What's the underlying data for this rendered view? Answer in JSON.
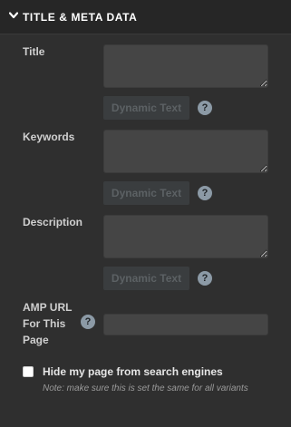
{
  "section": {
    "title": "TITLE & META DATA",
    "icon": "chevron-down-icon"
  },
  "fields": {
    "title": {
      "label": "Title",
      "value": "",
      "dynamic_text": "Dynamic Text",
      "help": "?"
    },
    "keywords": {
      "label": "Keywords",
      "value": "",
      "dynamic_text": "Dynamic Text",
      "help": "?"
    },
    "description": {
      "label": "Description",
      "value": "",
      "dynamic_text": "Dynamic Text",
      "help": "?"
    },
    "amp_url": {
      "label": "AMP URL For This Page",
      "value": "",
      "help": "?"
    }
  },
  "hide_from_search": {
    "label": "Hide my page from search engines",
    "checked": false,
    "note": "Note: make sure this is set the same for all variants"
  },
  "colors": {
    "panel_bg": "#2f2f2f",
    "header_bg": "#262626",
    "input_bg": "#454545",
    "help_icon": "#8c9aa6",
    "dynamic_button_text": "#5c6164"
  }
}
